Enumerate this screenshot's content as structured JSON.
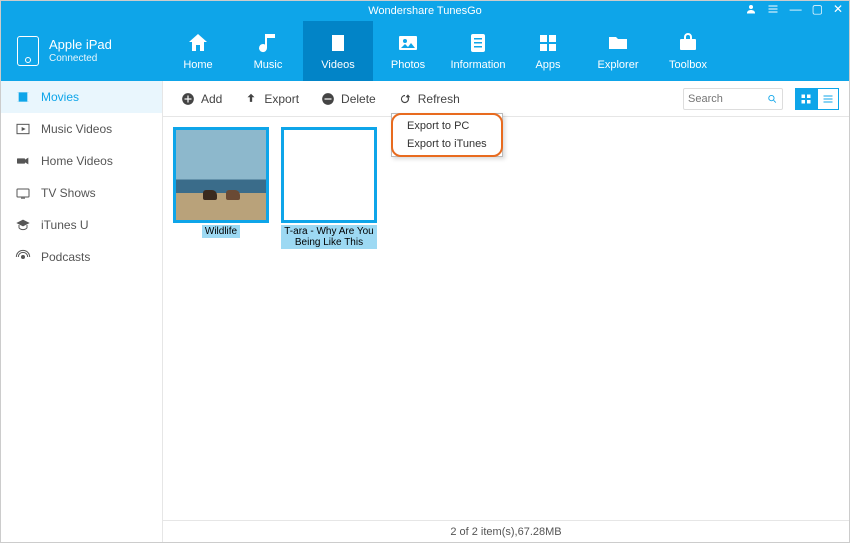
{
  "app": {
    "title": "Wondershare TunesGo"
  },
  "device": {
    "name": "Apple iPad",
    "status": "Connected"
  },
  "nav": {
    "home": "Home",
    "music": "Music",
    "videos": "Videos",
    "photos": "Photos",
    "information": "Information",
    "apps": "Apps",
    "explorer": "Explorer",
    "toolbox": "Toolbox",
    "active": "videos"
  },
  "sidebar": {
    "items": [
      {
        "id": "movies",
        "label": "Movies"
      },
      {
        "id": "music-videos",
        "label": "Music Videos"
      },
      {
        "id": "home-videos",
        "label": "Home Videos"
      },
      {
        "id": "tv-shows",
        "label": "TV Shows"
      },
      {
        "id": "itunes-u",
        "label": "iTunes U"
      },
      {
        "id": "podcasts",
        "label": "Podcasts"
      }
    ],
    "active": "movies"
  },
  "toolbar": {
    "add": "Add",
    "export": "Export",
    "delete": "Delete",
    "refresh": "Refresh",
    "search_placeholder": "Search"
  },
  "export_menu": {
    "to_pc": "Export to PC",
    "to_itunes": "Export to iTunes"
  },
  "items": [
    {
      "label": "Wildlife"
    },
    {
      "label": "T-ara - Why Are You Being Like This"
    }
  ],
  "status": "2 of 2 item(s),67.28MB"
}
